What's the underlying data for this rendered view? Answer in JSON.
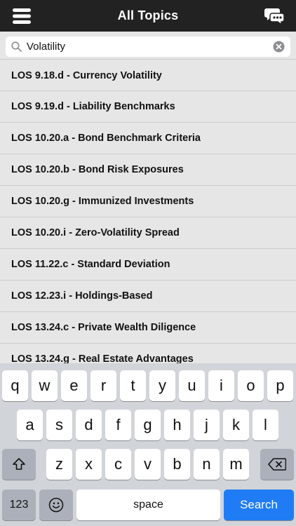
{
  "header": {
    "title": "All Topics",
    "menu_icon": "hamburger-menu-icon",
    "chat_icon": "chat-bubbles-icon"
  },
  "search": {
    "value": "Volatility",
    "placeholder": "Search"
  },
  "topics": [
    "LOS 9.18.d - Currency Volatility",
    "LOS 9.19.d - Liability Benchmarks",
    "LOS 10.20.a - Bond Benchmark Criteria",
    "LOS 10.20.b - Bond Risk Exposures",
    "LOS 10.20.g - Immunized Investments",
    "LOS 10.20.i - Zero-Volatility Spread",
    "LOS 11.22.c - Standard Deviation",
    "LOS 12.23.i - Holdings-Based",
    "LOS 13.24.c - Private Wealth Diligence",
    "LOS 13.24.g - Real Estate Advantages"
  ],
  "keyboard": {
    "row1": [
      "q",
      "w",
      "e",
      "r",
      "t",
      "y",
      "u",
      "i",
      "o",
      "p"
    ],
    "row2": [
      "a",
      "s",
      "d",
      "f",
      "g",
      "h",
      "j",
      "k",
      "l"
    ],
    "row3": [
      "z",
      "x",
      "c",
      "v",
      "b",
      "n",
      "m"
    ],
    "numbers_label": "123",
    "space_label": "space",
    "search_label": "Search"
  },
  "colors": {
    "navbar": "#222222",
    "background": "#e6e6e6",
    "keyboard": "#d1d4d9",
    "accent": "#1f7cf4"
  }
}
